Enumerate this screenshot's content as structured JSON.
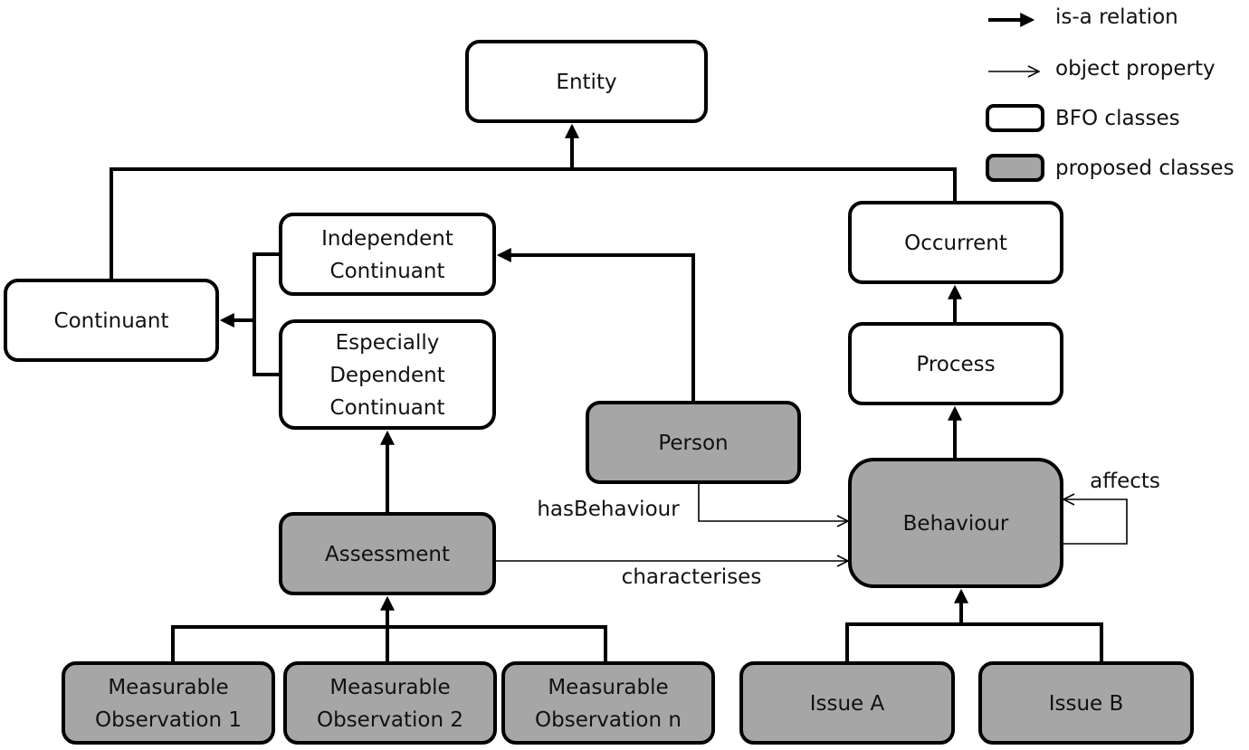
{
  "legend": {
    "isa": "is-a relation",
    "objprop": "object property",
    "bfo": "BFO classes",
    "proposed": "proposed classes"
  },
  "colors": {
    "bfo_fill": "#ffffff",
    "proposed_fill": "#a6a6a6",
    "stroke": "#000000"
  },
  "nodes": [
    {
      "id": "entity",
      "lines": [
        "Entity"
      ],
      "kind": "bfo"
    },
    {
      "id": "continuant",
      "lines": [
        "Continuant"
      ],
      "kind": "bfo"
    },
    {
      "id": "independent-continuant",
      "lines": [
        "Independent",
        "Continuant"
      ],
      "kind": "bfo"
    },
    {
      "id": "especially-dependent-continuant",
      "lines": [
        "Especially",
        "Dependent",
        "Continuant"
      ],
      "kind": "bfo"
    },
    {
      "id": "occurrent",
      "lines": [
        "Occurrent"
      ],
      "kind": "bfo"
    },
    {
      "id": "process",
      "lines": [
        "Process"
      ],
      "kind": "bfo"
    },
    {
      "id": "person",
      "lines": [
        "Person"
      ],
      "kind": "proposed"
    },
    {
      "id": "behaviour",
      "lines": [
        "Behaviour"
      ],
      "kind": "proposed"
    },
    {
      "id": "assessment",
      "lines": [
        "Assessment"
      ],
      "kind": "proposed"
    },
    {
      "id": "measurable-observation-1",
      "lines": [
        "Measurable",
        "Observation 1"
      ],
      "kind": "proposed"
    },
    {
      "id": "measurable-observation-2",
      "lines": [
        "Measurable",
        "Observation 2"
      ],
      "kind": "proposed"
    },
    {
      "id": "measurable-observation-n",
      "lines": [
        "Measurable",
        "Observation n"
      ],
      "kind": "proposed"
    },
    {
      "id": "issue-a",
      "lines": [
        "Issue A"
      ],
      "kind": "proposed"
    },
    {
      "id": "issue-b",
      "lines": [
        "Issue B"
      ],
      "kind": "proposed"
    }
  ],
  "edge_labels": {
    "hasBehaviour": "hasBehaviour",
    "characterises": "characterises",
    "affects": "affects"
  }
}
